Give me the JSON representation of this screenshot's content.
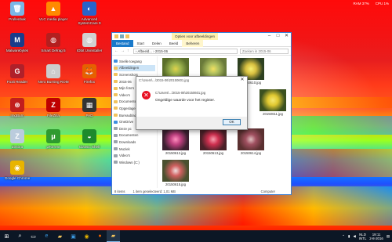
{
  "desktop_icons": [
    {
      "id": "prullenbak",
      "label": "Prullenbak",
      "icon": "recycle-bin-icon",
      "bg": "#7ab6e6",
      "glyph": "🗑"
    },
    {
      "id": "vlc",
      "label": "VLC media player",
      "icon": "vlc-icon",
      "bg": "#ff8a00",
      "glyph": "▲"
    },
    {
      "id": "advanced-systemcare",
      "label": "Advanced SystemCare 9",
      "icon": "systemcare-icon",
      "bg": "#2a63c9",
      "glyph": "◐"
    },
    {
      "id": "malwarebytes",
      "label": "Malwarebytes",
      "icon": "malwarebytes-icon",
      "bg": "#1a3c8a",
      "glyph": "M"
    },
    {
      "id": "smart-defrag",
      "label": "Smart Defrag 5",
      "icon": "defrag-icon",
      "bg": "#b31f1f",
      "glyph": "◍"
    },
    {
      "id": "iobit-app",
      "label": "IObit Uninstaller",
      "icon": "iobit-icon",
      "bg": "#d1d1d1",
      "glyph": "◍"
    },
    {
      "id": "foxit",
      "label": "Foxit Reader",
      "icon": "pdf-icon",
      "bg": "#b0202a",
      "glyph": "G"
    },
    {
      "id": "nero-burning",
      "label": "Nero Burning ROM",
      "icon": "nero-icon",
      "bg": "#cccccc",
      "glyph": "⌂"
    },
    {
      "id": "firefox",
      "label": "Firefox",
      "icon": "firefox-icon",
      "bg": "#e66000",
      "glyph": "🦊"
    },
    {
      "id": "imgburn",
      "label": "ImgBurn",
      "icon": "disc-icon",
      "bg": "#c21d1d",
      "glyph": "⊛"
    },
    {
      "id": "filezilla",
      "label": "FileZilla",
      "icon": "filezilla-icon",
      "bg": "#bf0000",
      "glyph": "Z"
    },
    {
      "id": "pad",
      "label": "PAD",
      "icon": "pad-icon",
      "bg": "#333",
      "glyph": "▦"
    },
    {
      "id": "z-app",
      "label": "Zimbra",
      "icon": "z-icon",
      "bg": "#bcd",
      "glyph": "Z"
    },
    {
      "id": "utorrent",
      "label": "µTorrent",
      "icon": "utorrent-icon",
      "bg": "#2f9a2f",
      "glyph": "μ"
    },
    {
      "id": "green-app",
      "label": "Classic Shell",
      "icon": "shell-icon",
      "bg": "#1e8a2c",
      "glyph": "◒"
    },
    {
      "id": "chrome",
      "label": "Google Chrome",
      "icon": "chrome-icon",
      "bg": "#e8b400",
      "glyph": "◉"
    }
  ],
  "tray_top": {
    "text1": "RAM 37%",
    "text2": "CPU 1%"
  },
  "explorer": {
    "context_tab": "Opties voor afbeeldingen",
    "tabs": [
      "Bestand",
      "Start",
      "Delen",
      "Beeld",
      "Beheren"
    ],
    "address": "› Afbeeld... › 2015-06",
    "search_placeholder": "Zoeken in 2015-06",
    "nav_items": [
      {
        "label": "Snelle toegang",
        "type": "blue",
        "selected": false
      },
      {
        "label": "Afbeeldingen",
        "type": "",
        "selected": true
      },
      {
        "label": "Screenshots",
        "type": "",
        "selected": false
      },
      {
        "label": "2015-06",
        "type": "",
        "selected": false
      },
      {
        "label": "Mijn foto's",
        "type": "",
        "selected": false
      },
      {
        "label": "Video's",
        "type": "",
        "selected": false
      },
      {
        "label": "Documenten",
        "type": "",
        "selected": false
      },
      {
        "label": "Opgeslagen",
        "type": "",
        "selected": false
      },
      {
        "label": "Bureaublad",
        "type": "",
        "selected": false
      },
      {
        "label": "OneDrive",
        "type": "blue",
        "selected": false
      },
      {
        "label": "Deze pc",
        "type": "grey",
        "selected": false
      },
      {
        "label": "Documenten",
        "type": "grey",
        "selected": false
      },
      {
        "label": "Downloads",
        "type": "grey",
        "selected": false
      },
      {
        "label": "Muziek",
        "type": "grey",
        "selected": false
      },
      {
        "label": "Video's",
        "type": "grey",
        "selected": false
      },
      {
        "label": "Windows (C:)",
        "type": "grey",
        "selected": false
      }
    ],
    "thumbs": [
      {
        "caption": "20150601.jpg",
        "colors": [
          "#5a6e2a",
          "#9fb64e",
          "#e0d24a"
        ]
      },
      {
        "caption": "20150603.jpg",
        "colors": [
          "#6a7a3a",
          "#b0c060",
          "#f2e060"
        ]
      },
      {
        "caption": "20150610.jpg",
        "colors": [
          "#2d4020",
          "#d8c040",
          "#f7f070"
        ]
      },
      {
        "caption": "20150611.jpg",
        "colors": [
          "#3b5020",
          "#e0c830",
          "#f5e870"
        ]
      },
      {
        "caption": "20150612.jpg",
        "colors": [
          "#3b2030",
          "#c04080",
          "#ff90c0"
        ]
      },
      {
        "caption": "20150613.jpg",
        "colors": [
          "#4a2028",
          "#d03050",
          "#f8a0b0"
        ]
      },
      {
        "caption": "20150614.jpg",
        "colors": [
          "#5a3030",
          "#a05060",
          "#e0c0c0"
        ]
      },
      {
        "caption": "20150615.jpg",
        "colors": [
          "#4a5030",
          "#d06060",
          "#f0e0e0"
        ]
      }
    ],
    "status_items": "8 items",
    "status_selected": "1 item geselecteerd: 1,01 MB",
    "status_right": "Computer"
  },
  "dialog": {
    "title": "C:\\Users\\...\\2015-06\\20150601.jpg",
    "path": "C:\\Users\\...\\2015-06\\20150601.jpg",
    "message": "Ongeldige waarde voor het register.",
    "ok_label": "OK"
  },
  "taskbar": {
    "items": [
      {
        "icon": "windows-start-icon",
        "glyph": "⊞",
        "color": "#fff"
      },
      {
        "icon": "search-icon",
        "glyph": "⌕",
        "color": "#fff"
      },
      {
        "icon": "task-view-icon",
        "glyph": "▭",
        "color": "#fff"
      },
      {
        "icon": "edge-icon",
        "glyph": "e",
        "color": "#3a96dd"
      },
      {
        "icon": "file-explorer-icon",
        "glyph": "▰",
        "color": "#f1c35d"
      },
      {
        "icon": "store-icon",
        "glyph": "▣",
        "color": "#3a96dd"
      },
      {
        "icon": "chrome-icon",
        "glyph": "◉",
        "color": "#e8b400"
      },
      {
        "icon": "firefox-icon",
        "glyph": "●",
        "color": "#e66000"
      },
      {
        "icon": "explorer-window-icon",
        "glyph": "▰",
        "color": "#f1c35d"
      }
    ],
    "lang": "NLD",
    "lang2": "INTL",
    "time": "19:11",
    "date": "2-8-2016"
  }
}
